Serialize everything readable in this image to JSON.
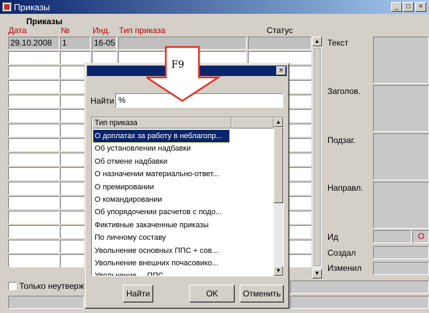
{
  "window": {
    "title": "Приказы",
    "min_label": "_",
    "max_label": "□",
    "close_label": "×"
  },
  "form": {
    "section_title": "Приказы",
    "headers": {
      "date": "Дата",
      "num": "№",
      "ind": "Инд.",
      "type": "Тип приказа",
      "status": "Статус"
    },
    "first_row": {
      "date": "29.10.2008",
      "num": "1",
      "ind": "16-05"
    },
    "right_labels": {
      "text": "Текст",
      "header": "Заголов.",
      "subheader": "Подзаг.",
      "direction": "Направл.",
      "id": "Ид",
      "created": "Создал",
      "changed": "Изменил"
    },
    "id_value_fragment": "О",
    "checkbox_label": "Только неутверж"
  },
  "annotation": {
    "key": "F9"
  },
  "dialog": {
    "find_label": "Найти",
    "find_value": "%",
    "list_header": "Тип приказа",
    "items": [
      "О доплатах за работу в неблагопр...",
      "Об установлении надбавки",
      "Об отмене надбавки",
      "О назначении материально-ответ...",
      "О премировании",
      "О командировании",
      "Об упорядочении расчетов с подо...",
      "Фиктивные закаченные приказы",
      "По личному составу",
      "Увольнение основных ППС + сов...",
      "Увольнение внешних почасовико...",
      "Увольнение ... ППС ..."
    ],
    "buttons": {
      "find": "Найти",
      "ok": "OK",
      "cancel": "Отменить"
    },
    "close_label": "×"
  },
  "colors": {
    "title_bar": "#0a246a",
    "label_red": "#c00000",
    "arrow_outline": "#e03020",
    "selection": "#0a246a"
  }
}
